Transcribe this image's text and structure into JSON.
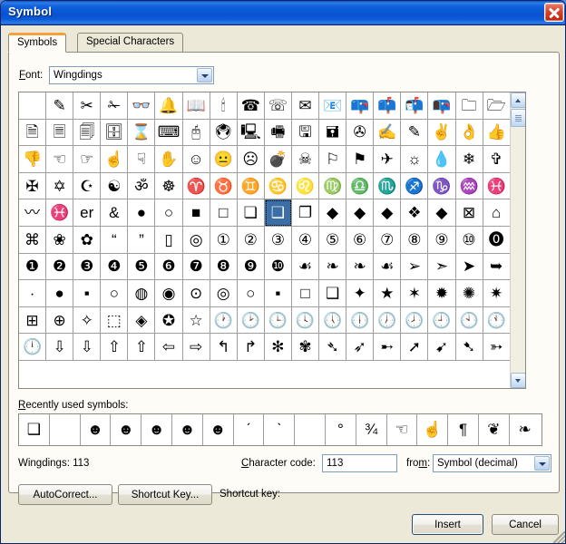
{
  "window": {
    "title": "Symbol",
    "close_icon": "close-icon"
  },
  "tabs": [
    {
      "label": "Symbols",
      "active": true
    },
    {
      "label": "Special Characters",
      "active": false
    }
  ],
  "font_row": {
    "label": "Font:",
    "value": "Wingdings",
    "arrow_icon": "chevron-down-icon"
  },
  "grid": {
    "columns": 18,
    "selected_index": 81,
    "rows": [
      [
        " ",
        "✎",
        "✂",
        "✁",
        "👓",
        "🔔",
        "📖",
        "🕯",
        "☎",
        "☏",
        "✉",
        "📧",
        "📪",
        "📫",
        "📬",
        "📭",
        "🗀",
        "🗁"
      ],
      [
        "🗎",
        "🗏",
        "🗐",
        "🗄",
        "⌛",
        "⌨",
        "🖰",
        "🖲",
        "🖳",
        "🖷",
        "🖫",
        "🖬",
        "✇",
        "✍",
        "✎",
        "✌",
        "👌",
        "👍"
      ],
      [
        "👎",
        "☜",
        "☞",
        "☝",
        "☟",
        "✋",
        "☺",
        "😐",
        "☹",
        "💣",
        "☠",
        "⚐",
        "⚑",
        "✈",
        "☼",
        "💧",
        "❄",
        "✞"
      ],
      [
        "✠",
        "✡",
        "☪",
        "☯",
        "ॐ",
        "☸",
        "♈",
        "♉",
        "♊",
        "♋",
        "♌",
        "♍",
        "♎",
        "♏",
        "♐",
        "♑",
        "♒",
        "♓"
      ],
      [
        "〰",
        "♓",
        "er",
        "&",
        "●",
        "○",
        "■",
        "□",
        "❏",
        "❑",
        "❐",
        "◆",
        "◆",
        "◆",
        "❖",
        "◆",
        "⊠",
        "⌂"
      ],
      [
        "⌘",
        "❀",
        "✿",
        "“",
        "”",
        "▯",
        "◎",
        "①",
        "②",
        "③",
        "④",
        "⑤",
        "⑥",
        "⑦",
        "⑧",
        "⑨",
        "⑩",
        "⓿"
      ],
      [
        "❶",
        "❷",
        "❸",
        "❹",
        "❺",
        "❻",
        "❼",
        "❽",
        "❾",
        "❿",
        "☙",
        "❧",
        "❧",
        "☙",
        "➢",
        "➣",
        "➤",
        "➥"
      ],
      [
        "·",
        "●",
        "▪",
        "○",
        "◍",
        "◉",
        "⊙",
        "◎",
        "○",
        "▪",
        "□",
        "❑",
        "✦",
        "★",
        "✶",
        "✹",
        "✺",
        "✷"
      ],
      [
        "⊞",
        "⊕",
        "✧",
        "⬚",
        "◈",
        "✪",
        "☆",
        "🕐",
        "🕑",
        "🕒",
        "🕓",
        "🕔",
        "🕕",
        "🕖",
        "🕗",
        "🕘",
        "🕙",
        "🕚"
      ],
      [
        "🕛",
        "⇩",
        "⇩",
        "⇧",
        "⇧",
        "⇦",
        "⇨",
        "↰",
        "↱",
        "✻",
        "✾",
        "➴",
        "➶",
        "➸",
        "➚",
        "➹",
        "➷",
        "➳"
      ]
    ]
  },
  "recent": {
    "label": "Recently used symbols:",
    "symbols": [
      "❑",
      " ",
      "☻",
      "☻",
      "☻",
      "☻",
      "☻",
      "ˊ",
      "ˋ",
      " ",
      "°",
      "¾",
      "☜",
      "☝",
      "¶",
      "❦",
      "❧"
    ]
  },
  "info": {
    "font_and_code": "Wingdings: 113",
    "charcode_label": "Character code:",
    "charcode_value": "113",
    "from_label": "from:",
    "from_value": "Symbol (decimal)",
    "from_arrow_icon": "chevron-down-icon"
  },
  "buttons": {
    "autocorrect": "AutoCorrect...",
    "shortcut_key": "Shortcut Key...",
    "shortcut_key_label": "Shortcut key:",
    "insert": "Insert",
    "cancel": "Cancel"
  },
  "colors": {
    "titlebar_blue": "#0a5ad8",
    "dialog_face": "#ece9d8",
    "panel_white": "#fdfcf7",
    "tab_accent_orange": "#f7a03c",
    "selection_blue": "#3a6ea5",
    "close_red": "#d8432c"
  }
}
